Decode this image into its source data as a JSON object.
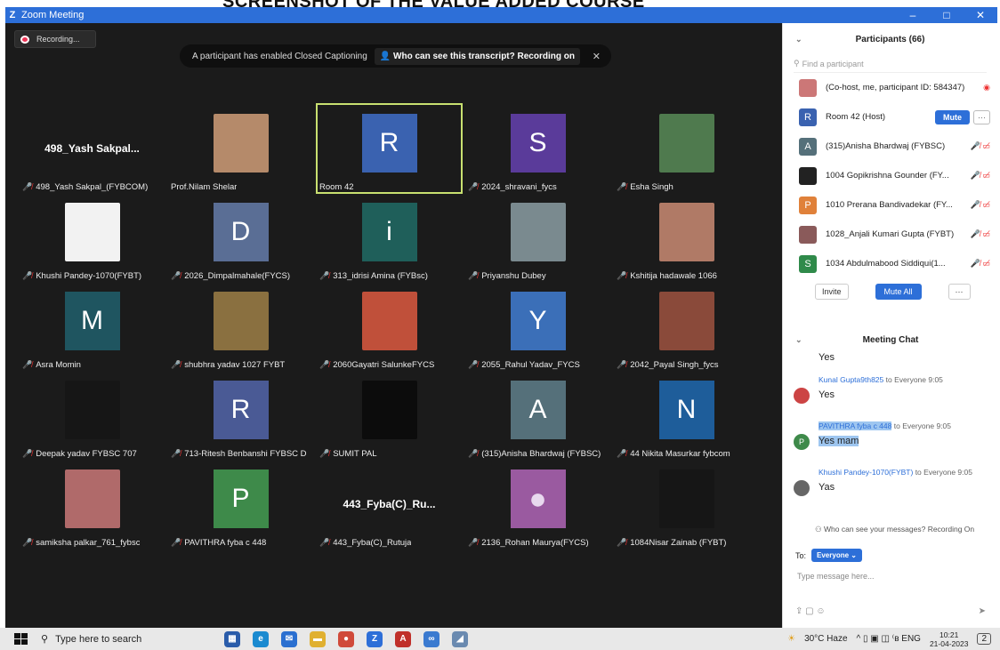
{
  "heading": "SCREENSHOT OF THE VALUE ADDED COURSE",
  "window": {
    "logo": "Z",
    "title": "Zoom Meeting",
    "controls": [
      "–",
      "□",
      "✕"
    ]
  },
  "recording": {
    "label": "Recording..."
  },
  "caption_banner": {
    "text": "A participant has enabled Closed Captioning",
    "link": "Who can see this transcript? Recording on",
    "close": "✕"
  },
  "tiles": [
    {
      "label": "498_Yash Sakpal_(FYBCOM)",
      "big_name": "498_Yash Sakpal...",
      "type": "name",
      "muted": true
    },
    {
      "label": "Prof.Nilam Shelar",
      "type": "photo",
      "color": "#b58a6a",
      "muted": false
    },
    {
      "label": "Room 42",
      "letter": "R",
      "type": "letter",
      "color": "#3a62b0",
      "muted": false,
      "active": true
    },
    {
      "label": "2024_shravani_fycs",
      "letter": "S",
      "type": "letter",
      "color": "#5a3b9a",
      "muted": true
    },
    {
      "label": "Esha Singh",
      "type": "photo",
      "color": "#4f7a4e",
      "muted": true
    },
    {
      "label": "Khushi Pandey-1070(FYBT)",
      "type": "photo",
      "color": "#f2f2f2",
      "muted": true
    },
    {
      "label": "2026_Dimpalmahale(FYCS)",
      "letter": "D",
      "type": "letter",
      "color": "#5a6e95",
      "muted": true
    },
    {
      "label": "313_idrisi Amina (FYBsc)",
      "letter": "i",
      "type": "letter",
      "color": "#1f5f5a",
      "muted": true
    },
    {
      "label": "Priyanshu Dubey",
      "type": "photo",
      "color": "#7a8a8f",
      "muted": true
    },
    {
      "label": "Kshitija hadawale 1066",
      "type": "photo",
      "color": "#b07a66",
      "muted": true
    },
    {
      "label": "Asra Momin",
      "letter": "M",
      "type": "letter",
      "color": "#1f5560",
      "muted": true
    },
    {
      "label": "shubhra yadav 1027 FYBT",
      "type": "photo",
      "color": "#8a7040",
      "muted": true
    },
    {
      "label": "2060Gayatri SalunkeFYCS",
      "type": "photo",
      "color": "#c0503a",
      "muted": true
    },
    {
      "label": "2055_Rahul Yadav_FYCS",
      "letter": "Y",
      "type": "letter",
      "color": "#3b6fb8",
      "muted": true
    },
    {
      "label": "2042_Payal Singh_fycs",
      "type": "photo",
      "color": "#8a4a3a",
      "muted": true
    },
    {
      "label": "Deepak yadav FYBSC 707",
      "type": "blank",
      "color": "#161616",
      "muted": true
    },
    {
      "label": "713-Ritesh Benbanshi FYBSC D",
      "letter": "R",
      "type": "letter",
      "color": "#4a5a95",
      "muted": true
    },
    {
      "label": "SUMIT PAL",
      "type": "photo",
      "color": "#0c0c0c",
      "muted": true
    },
    {
      "label": "(315)Anisha Bhardwaj (FYBSC)",
      "letter": "A",
      "type": "letter",
      "color": "#55707a",
      "muted": true
    },
    {
      "label": "44 Nikita Masurkar fybcom",
      "letter": "N",
      "type": "letter",
      "color": "#1e5d9a",
      "muted": true
    },
    {
      "label": "samiksha palkar_761_fybsc",
      "type": "photo",
      "color": "#b06a6a",
      "muted": true
    },
    {
      "label": "PAVITHRA fyba c 448",
      "letter": "P",
      "type": "letter",
      "color": "#3e8a4a",
      "muted": true
    },
    {
      "label": "443_Fyba(C)_Rutuja",
      "big_name": "443_Fyba(C)_Ru...",
      "type": "name",
      "muted": true
    },
    {
      "label": "2136_Rohan Maurya(FYCS)",
      "type": "avatar",
      "color": "#9a5aa0",
      "muted": true
    },
    {
      "label": "1084Nisar Zainab (FYBT)",
      "type": "blank",
      "color": "#161616",
      "muted": true
    }
  ],
  "participants": {
    "title": "Participants (66)",
    "search_placeholder": "Find a participant",
    "rows": [
      {
        "initial": "",
        "name": "(Co-host, me, participant ID: 584347)",
        "color": "#c77",
        "icons": "◉"
      },
      {
        "initial": "R",
        "name": "Room 42 (Host)",
        "color": "#3a62b0",
        "mute_button": "Mute",
        "more": "···"
      },
      {
        "initial": "A",
        "name": "(315)Anisha Bhardwaj (FYBSC)",
        "color": "#55707a",
        "icons": "🎤̸ ▭̸"
      },
      {
        "initial": "",
        "name": "1004 Gopikrishna Gounder (FY...",
        "color": "#222",
        "icons": "🎤̸ ▭̸"
      },
      {
        "initial": "P",
        "name": "1010 Prerana Bandivadekar (FY...",
        "color": "#e0813a",
        "icons": "🎤̸ ▭̸"
      },
      {
        "initial": "",
        "name": "1028_Anjali Kumari Gupta (FYBT)",
        "color": "#8a5a5a",
        "icons": "🎤̸ ▭̸"
      },
      {
        "initial": "S",
        "name": "1034 Abdulmabood Siddiqui(1...",
        "color": "#2f8a4a",
        "icons": "🎤̸ ▭̸"
      }
    ],
    "invite_label": "Invite",
    "mute_all_label": "Mute All",
    "more_label": "···"
  },
  "chat": {
    "title": "Meeting Chat",
    "messages": [
      {
        "sender": "",
        "text": "Yes",
        "initial": "",
        "color": "#666"
      },
      {
        "sender": "Kunal Gupta9th825",
        "to": "to Everyone 9:05",
        "text": "Yes",
        "initial": "",
        "color": "#c44"
      },
      {
        "sender": "PAVITHRA fyba c 448",
        "to": "to Everyone 9:05",
        "text": "Yes mam",
        "initial": "P",
        "color": "#3e8a4a"
      },
      {
        "sender": "Khushi Pandey-1070(FYBT)",
        "to": "to Everyone 9:05",
        "text": "Yas",
        "initial": "",
        "color": "#666"
      }
    ],
    "notice": "Who can see your messages? Recording On",
    "to_label": "To:",
    "to_value": "Everyone ⌄",
    "input_placeholder": "Type message here...",
    "tools": "⇪ ▢ ☺",
    "send": "➤"
  },
  "taskbar": {
    "search_placeholder": "Type here to search",
    "apps": [
      {
        "name": "store",
        "color": "#2a5caa",
        "glyph": "▦"
      },
      {
        "name": "edge",
        "color": "#1a8ad0",
        "glyph": "e"
      },
      {
        "name": "mail",
        "color": "#2a6fd0",
        "glyph": "✉"
      },
      {
        "name": "explorer",
        "color": "#e0b030",
        "glyph": "▬"
      },
      {
        "name": "chrome",
        "color": "#d04a3a",
        "glyph": "●"
      },
      {
        "name": "zoom",
        "color": "#2d6fd8",
        "glyph": "Z"
      },
      {
        "name": "pdf",
        "color": "#c0302a",
        "glyph": "A"
      },
      {
        "name": "app",
        "color": "#3a7ad0",
        "glyph": "∞"
      },
      {
        "name": "app2",
        "color": "#6a8ab0",
        "glyph": "◢"
      }
    ],
    "weather": "30°C Haze",
    "tray": "^ ▯ ▣ ◫ ⁽ʙ ENG",
    "time": "10:21",
    "date": "21-04-2023",
    "notification": "2"
  }
}
